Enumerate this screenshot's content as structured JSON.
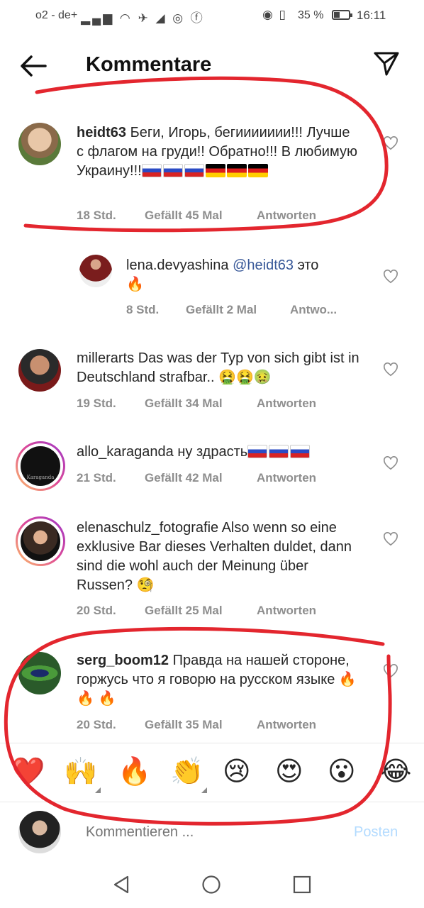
{
  "status_bar": {
    "carrier": "o2 - de+",
    "battery": "35 %",
    "time": "16:11"
  },
  "header": {
    "title": "Kommentare"
  },
  "comments": [
    {
      "username": "heidt63",
      "text": "Беги, Игорь, бегиииииии!!! Лучше с флагом на груди!! Обратно!!! В любимую Украину!!!",
      "time": "18 Std.",
      "likes": "Gefällt 45 Mal",
      "reply": "Antworten"
    },
    {
      "username": "lena.devyashina",
      "mention": "@heidt63",
      "text": "это",
      "time": "8 Std.",
      "likes": "Gefällt 2 Mal",
      "reply": "Antwo..."
    },
    {
      "username": "millerarts",
      "text": "Das was der Typ von sich gibt ist in Deutschland strafbar..",
      "time": "19 Std.",
      "likes": "Gefällt 34 Mal",
      "reply": "Antworten"
    },
    {
      "username": "allo_karaganda",
      "text": "ну здрасть",
      "time": "21 Std.",
      "likes": "Gefällt 42 Mal",
      "reply": "Antworten",
      "avatar_text": "Karaganda"
    },
    {
      "username": "elenaschulz_fotografie",
      "text": "Also wenn so eine exklusive Bar dieses Verhalten duldet, dann sind die wohl auch der Meinung über Russen?",
      "time": "20 Std.",
      "likes": "Gefällt 25 Mal",
      "reply": "Antworten"
    },
    {
      "username": "serg_boom12",
      "text": "Правда на нашей стороне, горжусь что я говорю на русском языке",
      "time": "20 Std.",
      "likes": "Gefällt 35 Mal",
      "reply": "Antworten"
    }
  ],
  "reactions": [
    "❤️",
    "🙌",
    "🔥",
    "👏",
    "😢",
    "😍",
    "😮",
    "😂"
  ],
  "composer": {
    "placeholder": "Kommentieren ...",
    "post_label": "Posten"
  },
  "colors": {
    "annotation_red": "#e3262e",
    "link_blue": "#385898",
    "post_disabled": "#b3dbff"
  }
}
